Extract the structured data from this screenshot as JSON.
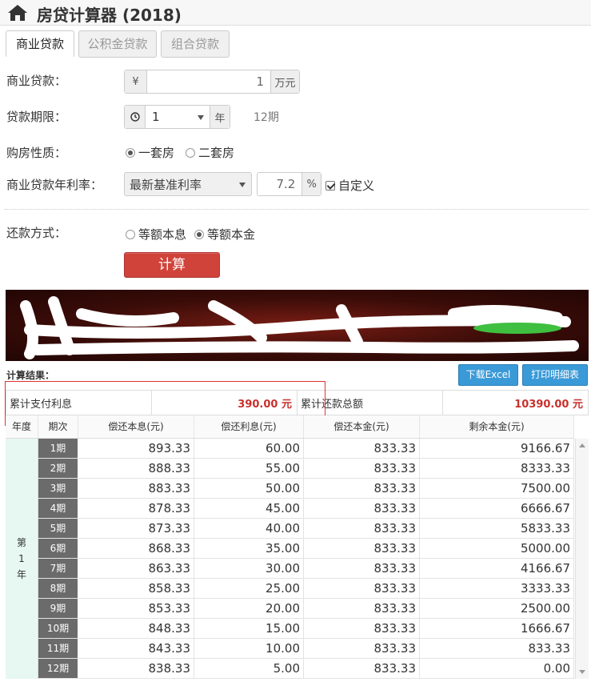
{
  "header": {
    "title": "房贷计算器 (2018)",
    "icon": "home-icon"
  },
  "tabs": [
    {
      "label": "商业贷款",
      "active": true
    },
    {
      "label": "公积金贷款",
      "active": false
    },
    {
      "label": "组合贷款",
      "active": false
    }
  ],
  "form": {
    "loan_amount": {
      "label": "商业贷款：",
      "prefix": "¥",
      "value": "1",
      "unit": "万元"
    },
    "loan_term": {
      "label": "贷款期限：",
      "value": "1",
      "unit": "年",
      "periods_text": "12期",
      "icon": "clock-icon"
    },
    "property": {
      "label": "购房性质：",
      "options": [
        "一套房",
        "二套房"
      ],
      "selected": "一套房"
    },
    "rate": {
      "label": "商业贷款年利率：",
      "select_value": "最新基准利率",
      "value": "7.2",
      "unit": "%",
      "custom_label": "自定义",
      "custom_checked": true
    },
    "repayment": {
      "label": "还款方式：",
      "options": [
        "等额本息",
        "等额本金"
      ],
      "selected": "等额本金"
    },
    "calc_button": "计算"
  },
  "results": {
    "label": "计算结果：",
    "download_excel": "下载Excel",
    "print_detail": "打印明细表",
    "total_interest_label": "累计支付利息",
    "total_interest": "390.00 元",
    "total_payment_label": "累计还款总额",
    "total_payment": "10390.00 元",
    "columns": [
      "年度",
      "期次",
      "偿还本息(元)",
      "偿还利息(元)",
      "偿还本金(元)",
      "剩余本金(元)"
    ],
    "year_label": [
      "第",
      "1",
      "年"
    ],
    "rows": [
      {
        "period": "1期",
        "payment": "893.33",
        "interest": "60.00",
        "principal": "833.33",
        "remaining": "9166.67"
      },
      {
        "period": "2期",
        "payment": "888.33",
        "interest": "55.00",
        "principal": "833.33",
        "remaining": "8333.33"
      },
      {
        "period": "3期",
        "payment": "883.33",
        "interest": "50.00",
        "principal": "833.33",
        "remaining": "7500.00"
      },
      {
        "period": "4期",
        "payment": "878.33",
        "interest": "45.00",
        "principal": "833.33",
        "remaining": "6666.67"
      },
      {
        "period": "5期",
        "payment": "873.33",
        "interest": "40.00",
        "principal": "833.33",
        "remaining": "5833.33"
      },
      {
        "period": "6期",
        "payment": "868.33",
        "interest": "35.00",
        "principal": "833.33",
        "remaining": "5000.00"
      },
      {
        "period": "7期",
        "payment": "863.33",
        "interest": "30.00",
        "principal": "833.33",
        "remaining": "4166.67"
      },
      {
        "period": "8期",
        "payment": "858.33",
        "interest": "25.00",
        "principal": "833.33",
        "remaining": "3333.33"
      },
      {
        "period": "9期",
        "payment": "853.33",
        "interest": "20.00",
        "principal": "833.33",
        "remaining": "2500.00"
      },
      {
        "period": "10期",
        "payment": "848.33",
        "interest": "15.00",
        "principal": "833.33",
        "remaining": "1666.67"
      },
      {
        "period": "11期",
        "payment": "843.33",
        "interest": "10.00",
        "principal": "833.33",
        "remaining": "833.33"
      },
      {
        "period": "12期",
        "payment": "838.33",
        "interest": "5.00",
        "principal": "833.33",
        "remaining": "0.00"
      }
    ]
  },
  "colors": {
    "accent_red": "#c9302c",
    "button_blue": "#3a9ad8",
    "period_gray": "#6b6b6b",
    "year_bg": "#e7f7f1"
  }
}
